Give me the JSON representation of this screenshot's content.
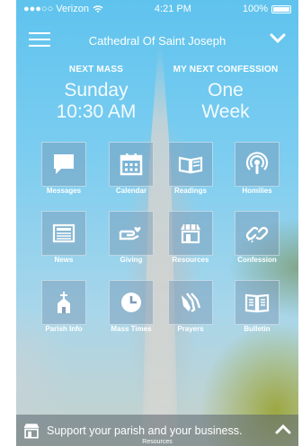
{
  "status_bar": {
    "carrier": "●●●○○ Verizon",
    "time": "4:21 PM",
    "battery": "100%"
  },
  "nav": {
    "title": "Cathedral Of Saint Joseph"
  },
  "next_mass": {
    "label": "NEXT MASS",
    "line1": "Sunday",
    "line2": "10:30 AM"
  },
  "next_confession": {
    "label": "MY NEXT CONFESSION",
    "line1": "One",
    "line2": "Week"
  },
  "tiles": [
    {
      "label": "Messages",
      "icon": "chat-bubble-icon"
    },
    {
      "label": "Calendar",
      "icon": "calendar-icon"
    },
    {
      "label": "Readings",
      "icon": "open-book-icon"
    },
    {
      "label": "Homilies",
      "icon": "podcast-icon"
    },
    {
      "label": "News",
      "icon": "newspaper-icon"
    },
    {
      "label": "Giving",
      "icon": "giving-hand-icon"
    },
    {
      "label": "Resources",
      "icon": "storefront-icon"
    },
    {
      "label": "Confession",
      "icon": "link-icon"
    },
    {
      "label": "Parish Info",
      "icon": "church-icon"
    },
    {
      "label": "Mass Times",
      "icon": "clock-icon"
    },
    {
      "label": "Prayers",
      "icon": "praying-hands-icon"
    },
    {
      "label": "Bulletin",
      "icon": "bulletin-book-icon"
    }
  ],
  "promo": {
    "text": "Support your parish and your business.",
    "sub_label": "Resources"
  }
}
